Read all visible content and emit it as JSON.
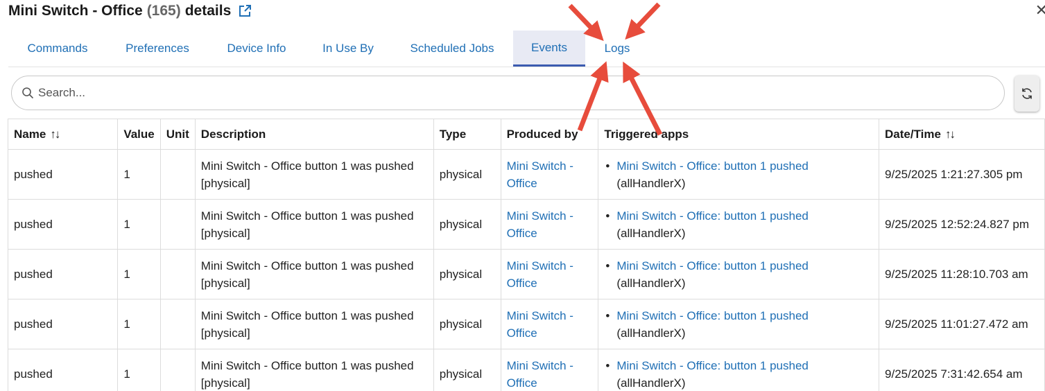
{
  "header": {
    "title": "Mini Switch - Office",
    "count": "(165)",
    "details": "details"
  },
  "tabs": [
    {
      "label": "Commands"
    },
    {
      "label": "Preferences"
    },
    {
      "label": "Device Info"
    },
    {
      "label": "In Use By"
    },
    {
      "label": "Scheduled Jobs"
    },
    {
      "label": "Events",
      "active": true
    },
    {
      "label": "Logs"
    }
  ],
  "search": {
    "placeholder": "Search..."
  },
  "table": {
    "columns": [
      "Name",
      "Value",
      "Unit",
      "Description",
      "Type",
      "Produced by",
      "Triggered apps",
      "Date/Time"
    ],
    "sort_icon": "↑↓",
    "rows": [
      {
        "name": "pushed",
        "value": "1",
        "unit": "",
        "description": "Mini Switch - Office button 1 was pushed [physical]",
        "type": "physical",
        "produced_by": "Mini Switch - Office",
        "app_link": "Mini Switch - Office: button 1 pushed",
        "app_handler": "(allHandlerX)",
        "datetime": "9/25/2025 1:21:27.305 pm"
      },
      {
        "name": "pushed",
        "value": "1",
        "unit": "",
        "description": "Mini Switch - Office button 1 was pushed [physical]",
        "type": "physical",
        "produced_by": "Mini Switch - Office",
        "app_link": "Mini Switch - Office: button 1 pushed",
        "app_handler": "(allHandlerX)",
        "datetime": "9/25/2025 12:52:24.827 pm"
      },
      {
        "name": "pushed",
        "value": "1",
        "unit": "",
        "description": "Mini Switch - Office button 1 was pushed [physical]",
        "type": "physical",
        "produced_by": "Mini Switch - Office",
        "app_link": "Mini Switch - Office: button 1 pushed",
        "app_handler": "(allHandlerX)",
        "datetime": "9/25/2025 11:28:10.703 am"
      },
      {
        "name": "pushed",
        "value": "1",
        "unit": "",
        "description": "Mini Switch - Office button 1 was pushed [physical]",
        "type": "physical",
        "produced_by": "Mini Switch - Office",
        "app_link": "Mini Switch - Office: button 1 pushed",
        "app_handler": "(allHandlerX)",
        "datetime": "9/25/2025 11:01:27.472 am"
      },
      {
        "name": "pushed",
        "value": "1",
        "unit": "",
        "description": "Mini Switch - Office button 1 was pushed [physical]",
        "type": "physical",
        "produced_by": "Mini Switch - Office",
        "app_link": "Mini Switch - Office: button 1 pushed",
        "app_handler": "(allHandlerX)",
        "datetime": "9/25/2025 7:31:42.654 am"
      }
    ]
  },
  "colors": {
    "link": "#1f6fb5",
    "active_tab_bg": "#e8eaf4",
    "arrow": "#e74c3c"
  },
  "icons": [
    "external-link-icon",
    "close-icon",
    "search-icon",
    "refresh-icon",
    "sort-icon",
    "annotation-arrow"
  ]
}
